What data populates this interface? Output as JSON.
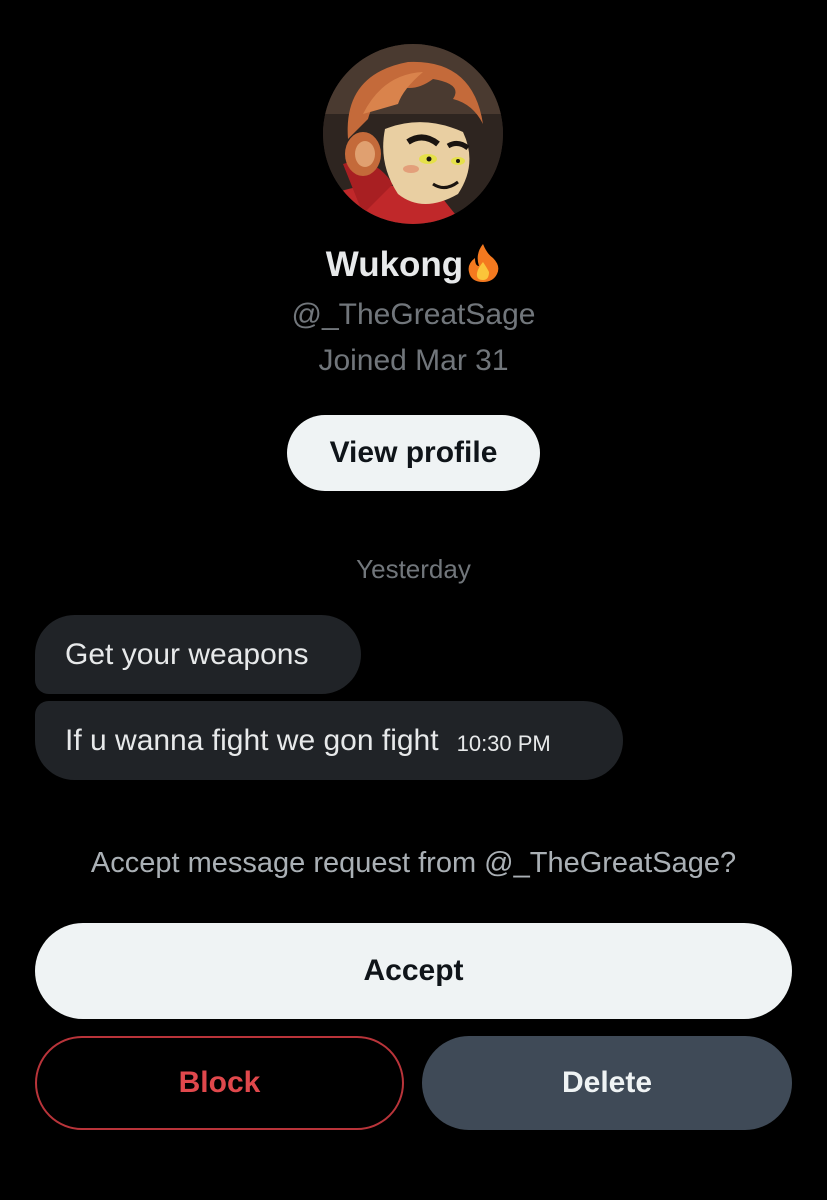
{
  "profile": {
    "display_name": "Wukong",
    "name_emoji_icon": "fire-icon",
    "handle": "@_TheGreatSage",
    "joined": "Joined Mar 31",
    "view_profile_label": "View profile"
  },
  "conversation": {
    "day_label": "Yesterday",
    "messages": [
      {
        "text": "Get your weapons",
        "time": ""
      },
      {
        "text": "If u wanna fight we gon fight",
        "time": "10:30 PM"
      }
    ]
  },
  "request": {
    "prompt": "Accept message request from @_TheGreatSage?",
    "accept_label": "Accept",
    "block_label": "Block",
    "delete_label": "Delete"
  },
  "colors": {
    "background": "#000000",
    "bubble": "#202327",
    "primary_button": "#eff3f4",
    "block_red": "#e0484c",
    "delete_button": "#3f4a57",
    "muted_text": "#71767b"
  }
}
